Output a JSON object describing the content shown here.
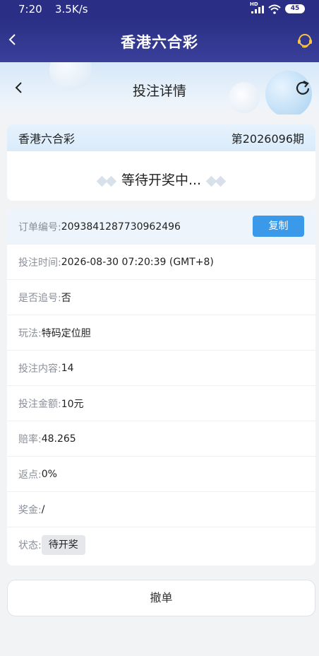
{
  "status_bar": {
    "time": "7:20",
    "speed": "3.5K/s",
    "hd": "HD",
    "battery": "45"
  },
  "app_header": {
    "title": "香港六合彩"
  },
  "sub_header": {
    "title": "投注详情"
  },
  "lottery": {
    "name": "香港六合彩",
    "period": "第2026096期",
    "status_text": "等待开奖中..."
  },
  "details": {
    "order_no": {
      "label": "订单编号:",
      "value": "2093841287730962496",
      "button": "复制"
    },
    "bet_time": {
      "label": "投注时间:",
      "value": "2026-08-30 07:20:39 (GMT+8)"
    },
    "chase": {
      "label": "是否追号:",
      "value": "否"
    },
    "play": {
      "label": "玩法:",
      "value": "特码定位胆"
    },
    "content": {
      "label": "投注内容:",
      "value": "14"
    },
    "amount": {
      "label": "投注金额:",
      "value": "10元"
    },
    "odds": {
      "label": "赔率:",
      "value": "48.265"
    },
    "rebate": {
      "label": "返点:",
      "value": "0%"
    },
    "prize": {
      "label": "奖金:",
      "value": "/"
    },
    "state": {
      "label": "状态:",
      "value": "待开奖"
    }
  },
  "cancel_button": "撤单",
  "colors": {
    "header_bg": "#2a2f85",
    "accent": "#3b99ea",
    "page_bg": "#f2f3f5"
  },
  "icons": [
    "back-icon",
    "customer-service-icon",
    "refresh-icon",
    "signal-icon",
    "wifi-icon",
    "battery-icon"
  ]
}
